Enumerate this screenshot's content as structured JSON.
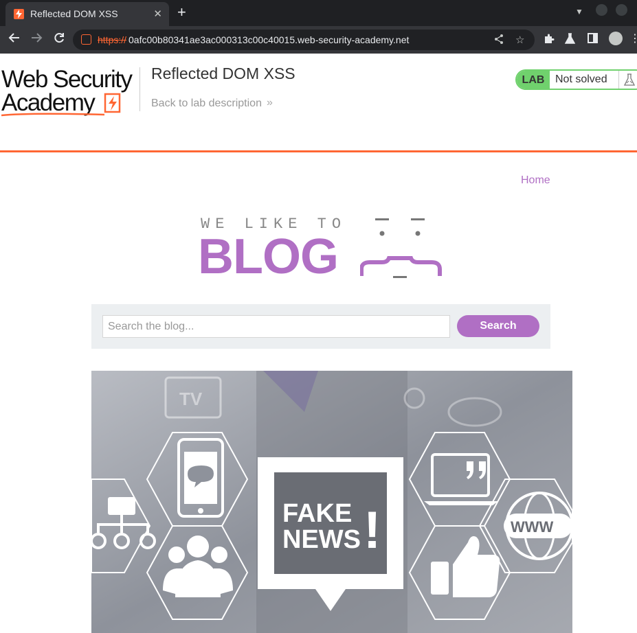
{
  "browser": {
    "tab_title": "Reflected DOM XSS",
    "url_scheme": "https://",
    "url_host": "0afc00b80341ae3ac000313c00c40015.web-security-academy.net"
  },
  "academy": {
    "logo_line1": "Web Security",
    "logo_line2": "Academy",
    "lab_title": "Reflected DOM XSS",
    "back_link": "Back to lab description",
    "lab_badge": "LAB",
    "lab_status": "Not solved",
    "accent_color": "#ff6633",
    "status_color": "#70d16d"
  },
  "blog": {
    "nav_home": "Home",
    "banner_tagline": "WE LIKE TO",
    "banner_title": "BLOG",
    "search_placeholder": "Search the blog...",
    "search_value": "",
    "search_button": "Search",
    "brand_color": "#b06fc4",
    "post_image": {
      "headline_line1": "FAKE",
      "headline_line2": "NEWS",
      "headline_mark": "!",
      "tv_label": "TV",
      "web_label": "WWW",
      "icons": [
        "tv-icon",
        "smartphone-icon",
        "org-chart-icon",
        "people-icon",
        "laptop-quote-icon",
        "thumbs-up-icon",
        "globe-www-icon"
      ]
    }
  }
}
